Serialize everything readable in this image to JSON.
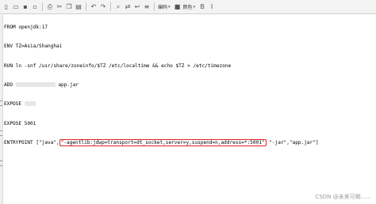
{
  "toolbar": {
    "icons": [
      "new-icon",
      "open-icon",
      "save-icon",
      "save-all-icon",
      "close-icon",
      "print-icon",
      "cut-icon",
      "copy-icon",
      "paste-icon",
      "undo-icon",
      "redo-icon",
      "find-icon",
      "replace-icon",
      "bold-icon",
      "italic-icon"
    ],
    "encoding_label": "编码",
    "color_label": "颜色"
  },
  "editor": {
    "lines": [
      "FROM openjdk:17",
      "ENV TZ=Asia/Shanghai",
      "RUN ln -snf /usr/share/zoneinfo/$TZ /etc/localtime && echo $TZ > /etc/timezone",
      "ADD",
      "EXPOSE",
      "EXPOSE 5001"
    ],
    "add_suffix": " app.jar",
    "entry_prefix": "ENTRYPOINT [\"java\",",
    "entry_highlight": "\"-agentlib:jdwp=transport=dt_socket,server=y,suspend=n,address=*:5001\"",
    "entry_suffix": " \"-jar\",\"app.jar\"]"
  },
  "watermark": "CSDN @未来可期......"
}
